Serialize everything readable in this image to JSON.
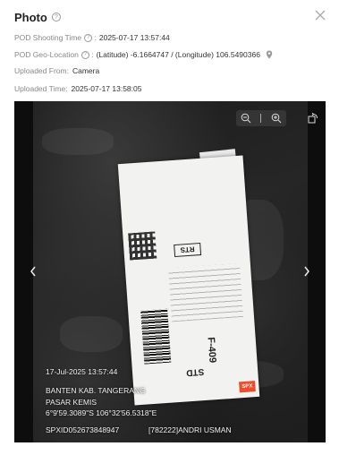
{
  "dialog": {
    "title": "Photo",
    "close_icon": "close-icon",
    "help_icon": "question-circle-icon"
  },
  "info": {
    "shooting_time": {
      "label": "POD Shooting Time",
      "value": "2025-07-17 13:57:44"
    },
    "geo_location": {
      "label": "POD Geo-Location",
      "value": "(Latitude) -6.1664747 / (Longitude) 106.5490366",
      "icon": "map-pin-icon"
    },
    "uploaded_from": {
      "label": "Uploaded From:",
      "value": "Camera"
    },
    "uploaded_time": {
      "label": "Uploaded Time:",
      "value": "2025-07-17 13:58:05"
    }
  },
  "viewer": {
    "zoom_out_icon": "zoom-out-icon",
    "zoom_in_icon": "zoom-in-icon",
    "rotate_icon": "rotate-icon",
    "prev_icon": "chevron-left-icon",
    "next_icon": "chevron-right-icon",
    "photo_overlay": {
      "timestamp": "17-Jul-2025 13:57:44",
      "address_line1": "BANTEN KAB. TANGERANG",
      "address_line2": "PASAR KEMIS",
      "coords": "6°9'59.3089\"S 106°32'56.5318\"E",
      "tracking": "SPXID052673848947",
      "courier": "[782222]ANDRI USMAN"
    },
    "label": {
      "rts": "RTS",
      "code": "F-409",
      "service": "STD",
      "brand": "SPX"
    }
  }
}
